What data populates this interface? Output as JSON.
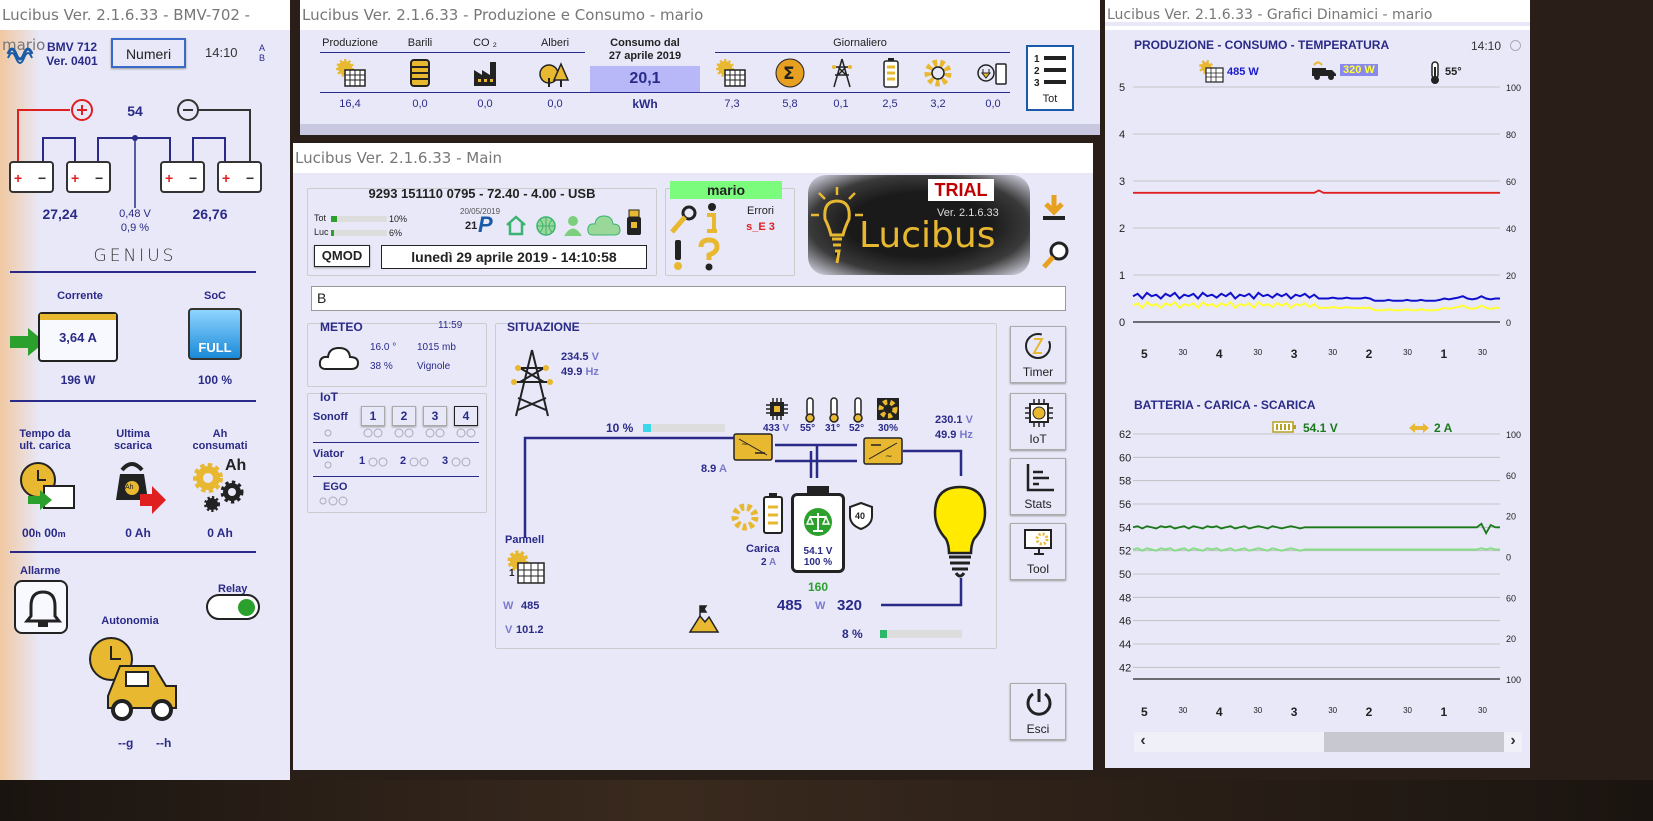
{
  "bmv": {
    "title": "Lucibus Ver. 2.1.6.33 - BMV-702 - mario",
    "model": "BMV 712",
    "version": "Ver. 0401",
    "numeri_btn": "Numeri",
    "time": "14:10",
    "ab": [
      "A",
      "B"
    ],
    "mid_value": "54",
    "left_v": "27,24",
    "right_v": "26,76",
    "mid_v": "0,48 V",
    "mid_pct": "0,9 %",
    "brand": "GENIUS",
    "corrente_label": "Corrente",
    "corrente_value": "3,64 A",
    "power": "196 W",
    "soc_label": "SoC",
    "soc_status": "FULL",
    "soc_value": "100 %",
    "tempo_label": "Tempo da ult. carica",
    "ultima_label": "Ultima scarica",
    "ah_label": "Ah consumati",
    "ah_icon": "Ah",
    "kettlebell_icon": "Ah",
    "tempo_h": "00",
    "tempo_h_unit": "h",
    "tempo_m": "00",
    "tempo_m_unit": "m",
    "ultima_value": "0 Ah",
    "ah_value": "0 Ah",
    "allarme_label": "Allarme",
    "relay_label": "Relay",
    "autonomia_label": "Autonomia",
    "autonomia_g": "--g",
    "autonomia_h": "--h"
  },
  "prod": {
    "title": "Lucibus Ver. 2.1.6.33 - Produzione e Consumo - mario",
    "headers": [
      "Produzione",
      "Barili",
      "CO ₂",
      "Alberi"
    ],
    "values": [
      "16,4",
      "0,0",
      "0,0",
      "0,0"
    ],
    "consumo_label": "Consumo dal",
    "consumo_date": "27 aprile 2019",
    "consumo_value": "20,1",
    "consumo_unit": "kWh",
    "giornaliero_label": "Giornaliero",
    "giornaliero_values": [
      "7,3",
      "5,8",
      "0,1",
      "2,5",
      "3,2",
      "0,0"
    ],
    "tot_label": "Tot"
  },
  "main": {
    "title": "Lucibus Ver. 2.1.6.33 - Main",
    "device": "9293 151110 0795  -  72.40 - 4.00  -  USB",
    "tot_label": "Tot",
    "tot_pct": "10%",
    "tot_fill": 0.1,
    "luc_label": "Luc",
    "luc_pct": "6%",
    "luc_fill": 0.06,
    "date_small": "20/05/2019",
    "day_num": "21",
    "p_letter": "P",
    "qmod_btn": "QMOD",
    "datetime": "lunedì 29 aprile 2019 - 14:10:58",
    "user": "mario",
    "errori_label": "Errori",
    "errori_value": "s_E 3",
    "trial": "TRIAL",
    "logo_ver": "Ver. 2.1.6.33",
    "logo_name": "Lucibus",
    "input_value": "B",
    "meteo": {
      "title": "METEO",
      "time": "11:59",
      "temp": "16.0 °",
      "pressure": "1015 mb",
      "humidity": "38 %",
      "place": "Vignole"
    },
    "iot": {
      "title": "IoT",
      "sonoff_label": "Sonoff",
      "sonoff_buttons": [
        "1",
        "2",
        "3",
        "4"
      ],
      "viator_label": "Viator",
      "viator_items": [
        "1",
        "2",
        "3"
      ],
      "ego_label": "EGO"
    },
    "situazione": {
      "title": "SITUAZIONE",
      "grid_v": "234.5",
      "grid_v_unit": "V",
      "grid_hz": "49.9",
      "grid_hz_unit": "Hz",
      "pct1": "10 %",
      "pct1_fill": 0.1,
      "current": "8.9",
      "current_unit": "A",
      "inv_v": "433",
      "inv_v_unit": "V",
      "temps": [
        "55°",
        "31°",
        "52°"
      ],
      "fan": "30%",
      "out_v": "230.1",
      "out_v_unit": "V",
      "out_hz": "49.9",
      "out_hz_unit": "Hz",
      "pannell_label": "Pannell",
      "pannell_num": "1",
      "w_label": "W",
      "w_value": "485",
      "v_label": "V",
      "v_value": "101.2",
      "carica_label": "Carica",
      "carica_value": "2",
      "carica_unit": "A",
      "batt_v": "54.1 V",
      "batt_pct": "100 %",
      "shield_num": "40",
      "batt_num": "160",
      "w_in": "485",
      "w_unit": "W",
      "w_out": "320",
      "pct2": "8 %",
      "pct2_fill": 0.08
    },
    "side_buttons": [
      "Timer",
      "IoT",
      "Stats",
      "Tool"
    ],
    "esci": "Esci"
  },
  "grafici": {
    "title": "Lucibus Ver. 2.1.6.33 - Grafici Dinamici - mario",
    "time": "14:10",
    "scroll_left": "‹",
    "scroll_right": "›"
  },
  "chart_data": [
    {
      "type": "line",
      "title": "PRODUZIONE - CONSUMO - TEMPERATURA",
      "legend": [
        "485 W",
        "320 W",
        "55°"
      ],
      "x_ticks": [
        "5",
        "30",
        "4",
        "30",
        "3",
        "30",
        "2",
        "30",
        "1",
        "30"
      ],
      "y_left_ticks": [
        0,
        1,
        2,
        3,
        4,
        5
      ],
      "y_right_ticks": [
        0,
        20,
        40,
        60,
        80,
        100
      ],
      "ylim": [
        0,
        5
      ],
      "grid": false,
      "series": [
        {
          "color": "#e02020",
          "values": [
            2.75,
            2.75,
            2.75,
            2.75,
            2.75,
            2.75,
            2.75,
            2.75,
            2.75,
            2.75,
            2.75,
            2.75,
            2.75,
            2.75,
            2.75,
            2.75,
            2.75,
            2.75,
            2.75,
            2.75,
            2.75,
            2.75,
            2.75,
            2.75,
            2.75,
            2.75,
            2.75,
            2.75,
            2.75,
            2.75,
            2.75,
            2.75,
            2.75,
            2.75,
            2.75,
            2.75,
            2.75,
            2.75,
            2.75,
            2.75,
            2.8,
            2.75,
            2.75,
            2.75,
            2.75,
            2.75,
            2.75,
            2.75,
            2.75,
            2.75,
            2.75,
            2.75,
            2.75,
            2.75,
            2.75,
            2.75,
            2.75,
            2.75,
            2.75,
            2.75,
            2.75,
            2.75,
            2.75,
            2.75,
            2.75,
            2.75,
            2.75,
            2.75,
            2.75,
            2.75,
            2.75,
            2.75,
            2.75,
            2.75,
            2.75,
            2.75,
            2.75,
            2.75,
            2.75,
            2.75
          ]
        },
        {
          "color": "#1010cc",
          "values": [
            0.55,
            0.6,
            0.5,
            0.62,
            0.55,
            0.58,
            0.5,
            0.6,
            0.55,
            0.62,
            0.5,
            0.58,
            0.55,
            0.6,
            0.5,
            0.62,
            0.55,
            0.58,
            0.52,
            0.6,
            0.55,
            0.62,
            0.5,
            0.58,
            0.55,
            0.6,
            0.5,
            0.62,
            0.55,
            0.58,
            0.52,
            0.6,
            0.55,
            0.6,
            0.5,
            0.58,
            0.55,
            0.6,
            0.52,
            0.58,
            0.5,
            0.5,
            0.5,
            0.52,
            0.5,
            0.5,
            0.52,
            0.5,
            0.5,
            0.5,
            0.52,
            0.5,
            0.45,
            0.45,
            0.45,
            0.47,
            0.45,
            0.45,
            0.45,
            0.47,
            0.45,
            0.45,
            0.47,
            0.45,
            0.45,
            0.45,
            0.47,
            0.5,
            0.48,
            0.5,
            0.52,
            0.55,
            0.5,
            0.48,
            0.5,
            0.55,
            0.5,
            0.48,
            0.5,
            0.5
          ]
        },
        {
          "color": "#ffff33",
          "values": [
            0.35,
            0.4,
            0.3,
            0.42,
            0.35,
            0.38,
            0.3,
            0.4,
            0.35,
            0.42,
            0.3,
            0.38,
            0.35,
            0.4,
            0.3,
            0.42,
            0.35,
            0.38,
            0.32,
            0.4,
            0.35,
            0.42,
            0.3,
            0.38,
            0.35,
            0.4,
            0.3,
            0.42,
            0.35,
            0.38,
            0.32,
            0.4,
            0.35,
            0.4,
            0.3,
            0.38,
            0.35,
            0.4,
            0.32,
            0.38,
            0.3,
            0.3,
            0.3,
            0.32,
            0.3,
            0.3,
            0.32,
            0.3,
            0.3,
            0.3,
            0.3,
            0.3,
            0.25,
            0.25,
            0.25,
            0.27,
            0.25,
            0.25,
            0.25,
            0.27,
            0.25,
            0.25,
            0.27,
            0.25,
            0.25,
            0.25,
            0.27,
            0.3,
            0.28,
            0.3,
            0.32,
            0.35,
            0.3,
            0.28,
            0.3,
            0.35,
            0.3,
            0.28,
            0.3,
            0.3
          ]
        }
      ]
    },
    {
      "type": "line",
      "title": "BATTERIA - CARICA - SCARICA",
      "legend": [
        "54.1 V",
        "2 A"
      ],
      "x_ticks": [
        "5",
        "30",
        "4",
        "30",
        "3",
        "30",
        "2",
        "30",
        "1",
        "30"
      ],
      "y_left_ticks": [
        42,
        44,
        46,
        48,
        50,
        52,
        54,
        56,
        58,
        60,
        62
      ],
      "y_right_ticks": [
        "100",
        "20",
        "60",
        "0",
        "20",
        "60",
        "100"
      ],
      "ylim": [
        41,
        62
      ],
      "grid": false,
      "series": [
        {
          "color": "#1a7a1a",
          "values": [
            54.0,
            54.1,
            53.9,
            54.1,
            54.0,
            53.9,
            54.1,
            54.0,
            54.1,
            53.9,
            54.0,
            54.1,
            53.9,
            54.1,
            54.0,
            53.9,
            54.1,
            54.0,
            54.1,
            53.9,
            54.0,
            54.1,
            53.9,
            54.0,
            54.1,
            53.9,
            54.0,
            54.1,
            54.0,
            53.9,
            54.1,
            54.0,
            53.9,
            54.0,
            54.1,
            54.0,
            53.9,
            54.0,
            54.0,
            54.0,
            54.0,
            54.0,
            54.0,
            54.0,
            54.0,
            54.0,
            54.0,
            54.0,
            54.0,
            54.0,
            54.0,
            54.0,
            54.0,
            54.0,
            54.0,
            54.0,
            54.0,
            54.0,
            54.0,
            54.0,
            54.0,
            54.0,
            54.0,
            54.0,
            54.0,
            54.0,
            54.0,
            54.0,
            54.0,
            54.0,
            54.0,
            54.0,
            54.0,
            54.0,
            54.0,
            54.3,
            53.5,
            54.2,
            54.0,
            54.0
          ]
        },
        {
          "color": "#88dd88",
          "values": [
            52.1,
            52.2,
            52.0,
            52.2,
            52.1,
            52.0,
            52.2,
            52.1,
            52.2,
            52.0,
            52.1,
            52.2,
            52.0,
            52.2,
            52.1,
            52.0,
            52.2,
            52.1,
            52.2,
            52.0,
            52.1,
            52.2,
            52.0,
            52.1,
            52.2,
            52.0,
            52.1,
            52.2,
            52.1,
            52.0,
            52.2,
            52.1,
            52.0,
            52.1,
            52.2,
            52.1,
            52.0,
            52.1,
            52.1,
            52.1,
            52.1,
            52.1,
            52.1,
            52.1,
            52.1,
            52.1,
            52.1,
            52.1,
            52.1,
            52.1,
            52.1,
            52.1,
            52.1,
            52.1,
            52.1,
            52.1,
            52.1,
            52.1,
            52.1,
            52.1,
            52.1,
            52.1,
            52.1,
            52.1,
            52.1,
            52.1,
            52.1,
            52.1,
            52.1,
            52.1,
            52.1,
            52.1,
            52.1,
            52.1,
            52.1,
            52.2,
            52.1,
            52.2,
            52.1,
            52.1
          ]
        }
      ]
    }
  ]
}
